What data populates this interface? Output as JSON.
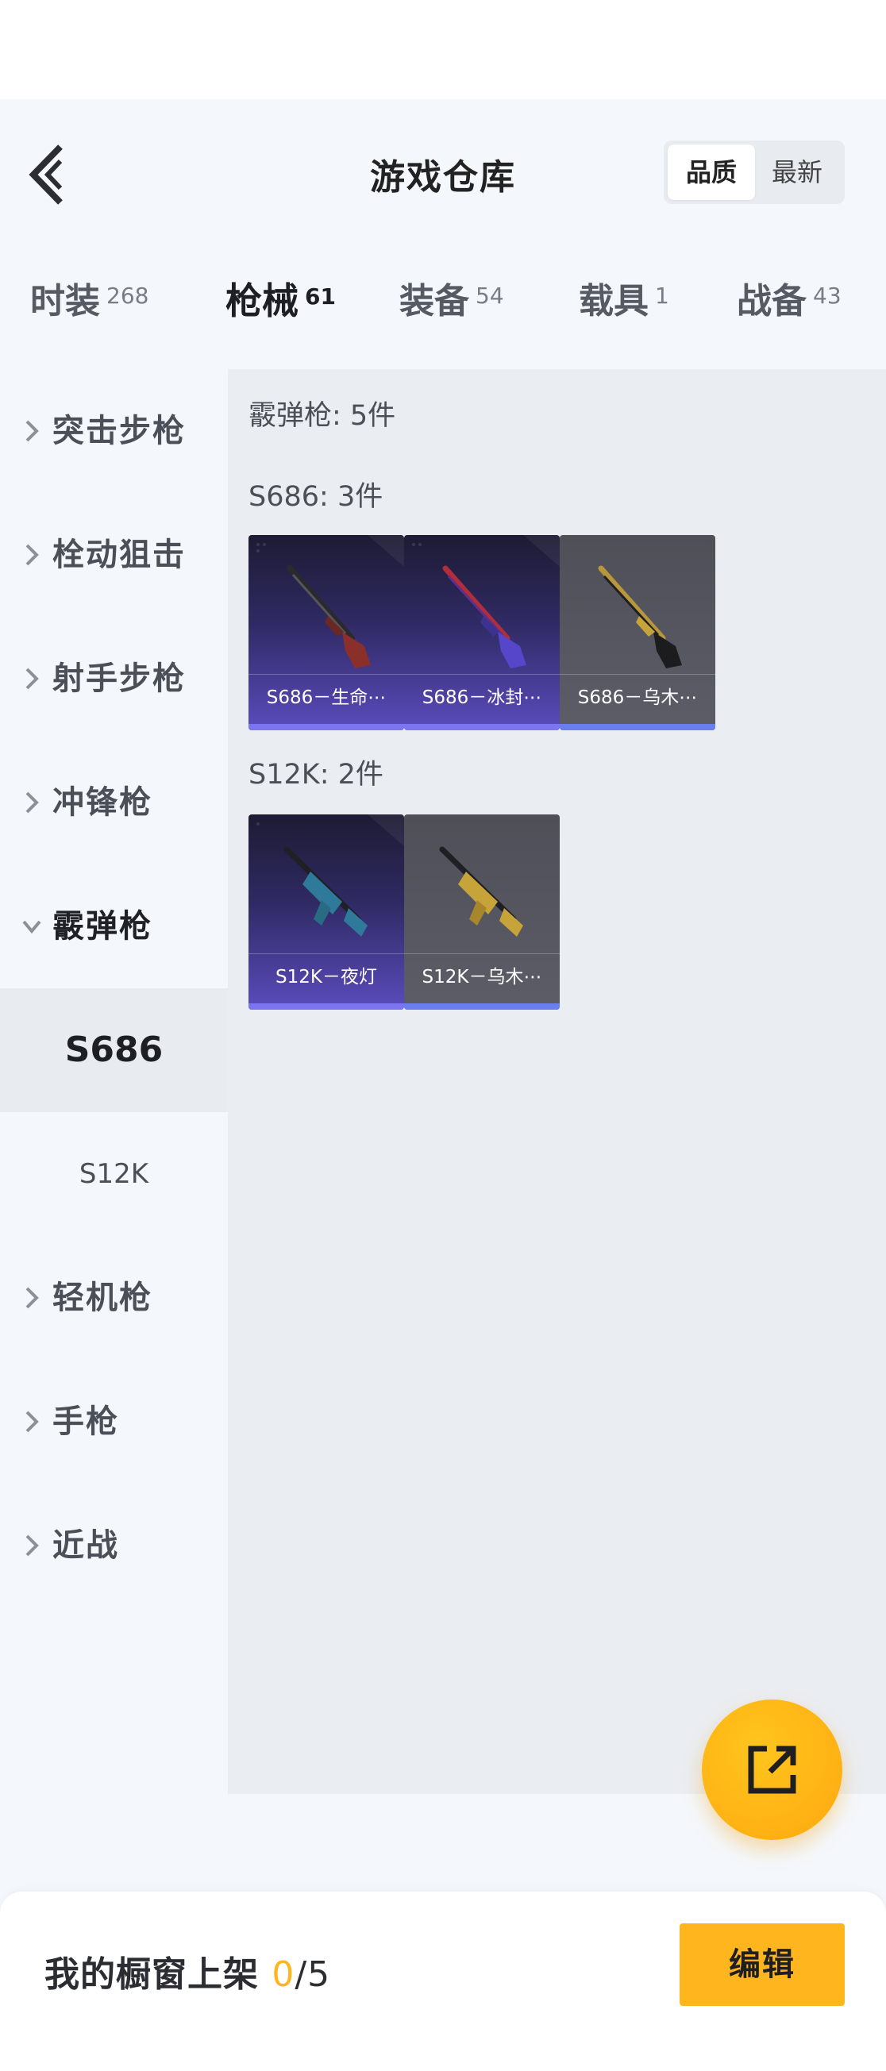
{
  "header": {
    "title": "游戏仓库",
    "sort_options": [
      "品质",
      "最新"
    ],
    "sort_selected": "品质"
  },
  "tabs": [
    {
      "label": "时装",
      "count": "268",
      "active": false
    },
    {
      "label": "枪械",
      "count": "61",
      "active": true
    },
    {
      "label": "装备",
      "count": "54",
      "active": false
    },
    {
      "label": "载具",
      "count": "1",
      "active": false
    },
    {
      "label": "战备",
      "count": "43",
      "active": false
    }
  ],
  "sidebar": {
    "categories": [
      {
        "label": "突击步枪"
      },
      {
        "label": "栓动狙击"
      },
      {
        "label": "射手步枪"
      },
      {
        "label": "冲锋枪"
      },
      {
        "label": "霰弹枪",
        "expanded": true
      },
      {
        "label": "轻机枪"
      },
      {
        "label": "手枪"
      },
      {
        "label": "近战"
      }
    ],
    "subitems": [
      {
        "label": "S686",
        "active": true
      },
      {
        "label": "S12K",
        "active": false
      }
    ]
  },
  "content": {
    "summary": "霰弹枪: 5件",
    "groups": [
      {
        "title": "S686: 3件",
        "items": [
          {
            "name": "S686－生命⋯",
            "rarity": "epic",
            "color": "#8a2f2a"
          },
          {
            "name": "S686－冰封⋯",
            "rarity": "epic",
            "color": "#b02d3a"
          },
          {
            "name": "S686－乌木⋯",
            "rarity": "rare",
            "color": "#c7a43a"
          }
        ]
      },
      {
        "title": "S12K: 2件",
        "items": [
          {
            "name": "S12K－夜灯",
            "rarity": "epic",
            "color": "#2f7a9a"
          },
          {
            "name": "S12K－乌木⋯",
            "rarity": "rare",
            "color": "#c7a43a"
          }
        ]
      }
    ]
  },
  "fab": {
    "icon": "share-out-icon"
  },
  "bottom": {
    "label": "我的橱窗上架",
    "count": "0",
    "total": "/5",
    "edit_label": "编辑"
  },
  "colors": {
    "accent": "#ffb51e",
    "epic": "#5a4cbd",
    "rare_bar": "#7c74f0"
  }
}
